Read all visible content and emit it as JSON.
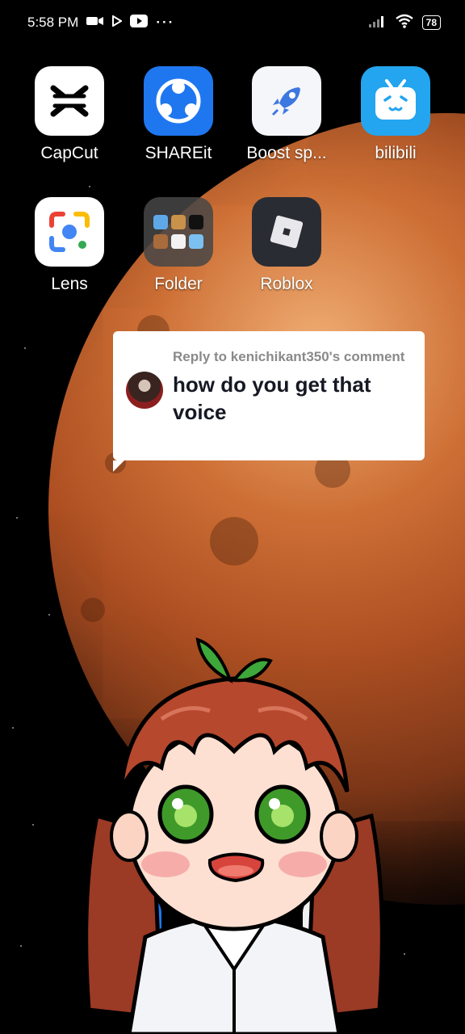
{
  "status_bar": {
    "time": "5:58 PM",
    "battery": "78",
    "icons_left": [
      "camera-icon",
      "play-icon",
      "youtube-icon",
      "more-icon"
    ],
    "icons_right": [
      "signal-icon",
      "wifi-icon",
      "battery-icon"
    ]
  },
  "apps": [
    {
      "label": "CapCut",
      "icon": "capcut-icon",
      "color": "#ffffff"
    },
    {
      "label": "SHAREit",
      "icon": "shareit-icon",
      "color": "#1f77f0"
    },
    {
      "label": "Boost sp...",
      "icon": "rocket-icon",
      "color": "#f5f6fa"
    },
    {
      "label": "bilibili",
      "icon": "bilibili-icon",
      "color": "#23a5f0"
    },
    {
      "label": "Lens",
      "icon": "lens-icon",
      "color": "#ffffff"
    },
    {
      "label": "Folder",
      "icon": "folder-icon",
      "color": "#3a3a3a"
    },
    {
      "label": "Roblox",
      "icon": "roblox-icon",
      "color": "#2a2c33"
    }
  ],
  "reply": {
    "heading": "Reply to kenichikant350's comment",
    "text": "how do you get that voice"
  }
}
